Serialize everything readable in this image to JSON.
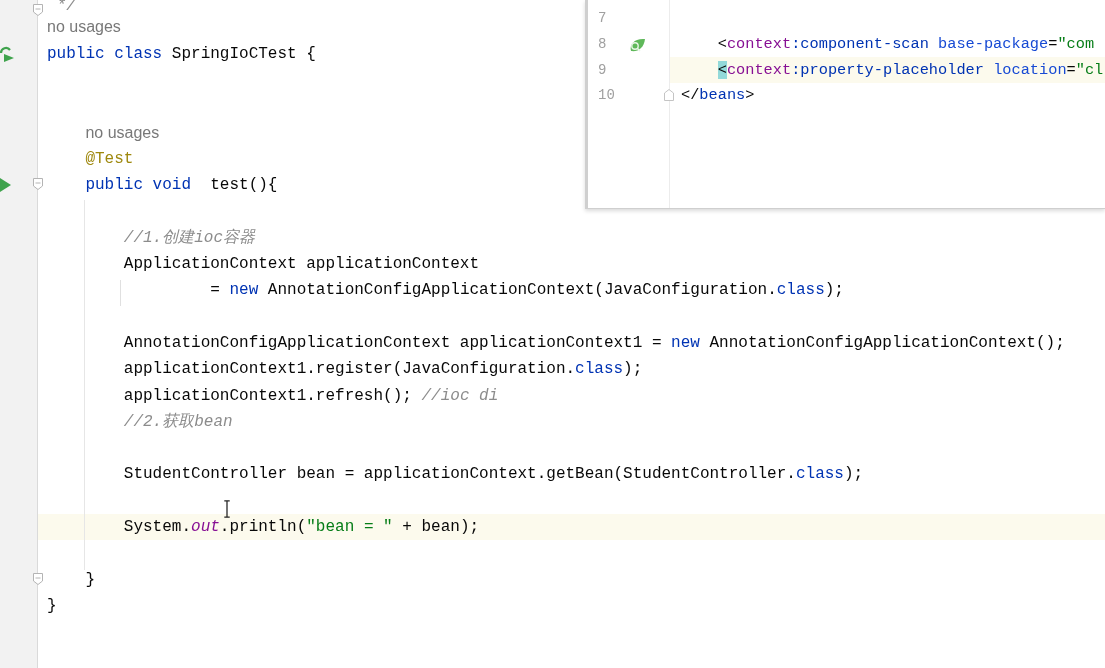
{
  "editor": {
    "lines": [
      {
        "kind": "code",
        "markers": [
          {
            "kind": "fold"
          }
        ],
        "tokens": [
          {
            "text": " */",
            "kind": "comment"
          }
        ]
      },
      {
        "kind": "hint",
        "text": "no usages"
      },
      {
        "kind": "code",
        "markers": [
          {
            "kind": "run-class"
          }
        ],
        "tokens": [
          {
            "text": "public class ",
            "kind": "keyword"
          },
          {
            "text": "SpringIoCTest {",
            "kind": "plain"
          }
        ]
      },
      {
        "kind": "blank"
      },
      {
        "kind": "blank"
      },
      {
        "kind": "hint",
        "text": "    no usages"
      },
      {
        "kind": "code",
        "tokens": [
          {
            "text": "    @Test",
            "kind": "annotation"
          }
        ]
      },
      {
        "kind": "code",
        "markers": [
          {
            "kind": "run"
          },
          {
            "kind": "fold"
          }
        ],
        "tokens": [
          {
            "text": "    public void ",
            "kind": "keyword"
          },
          {
            "text": " test(){",
            "kind": "plain"
          }
        ]
      },
      {
        "kind": "blank"
      },
      {
        "kind": "code",
        "tokens": [
          {
            "text": "        //1.创建ioc容器",
            "kind": "comment"
          }
        ]
      },
      {
        "kind": "code",
        "tokens": [
          {
            "text": "        ApplicationContext applicationContext",
            "kind": "plain"
          }
        ]
      },
      {
        "kind": "code",
        "tokens": [
          {
            "text": "                 = ",
            "kind": "plain"
          },
          {
            "text": "new ",
            "kind": "keyword"
          },
          {
            "text": "AnnotationConfigApplicationContext(JavaConfiguration.",
            "kind": "plain"
          },
          {
            "text": "class",
            "kind": "keyword"
          },
          {
            "text": ");",
            "kind": "plain"
          }
        ]
      },
      {
        "kind": "blank"
      },
      {
        "kind": "code",
        "tokens": [
          {
            "text": "        AnnotationConfigApplicationContext applicationContext1 = ",
            "kind": "plain"
          },
          {
            "text": "new ",
            "kind": "keyword"
          },
          {
            "text": "AnnotationConfigApplicationContext();",
            "kind": "plain"
          }
        ]
      },
      {
        "kind": "code",
        "tokens": [
          {
            "text": "        applicationContext1.register(JavaConfiguration.",
            "kind": "plain"
          },
          {
            "text": "class",
            "kind": "keyword"
          },
          {
            "text": ");",
            "kind": "plain"
          }
        ]
      },
      {
        "kind": "code",
        "tokens": [
          {
            "text": "        applicationContext1.refresh(); ",
            "kind": "plain"
          },
          {
            "text": "//ioc di",
            "kind": "comment"
          }
        ]
      },
      {
        "kind": "code",
        "tokens": [
          {
            "text": "        //2.获取bean",
            "kind": "comment"
          }
        ]
      },
      {
        "kind": "blank"
      },
      {
        "kind": "code",
        "tokens": [
          {
            "text": "        StudentController bean = applicationContext.getBean(StudentController.",
            "kind": "plain"
          },
          {
            "text": "class",
            "kind": "keyword"
          },
          {
            "text": ");",
            "kind": "plain"
          }
        ]
      },
      {
        "kind": "blank"
      },
      {
        "kind": "code",
        "current": true,
        "tokens": [
          {
            "text": "        System.",
            "kind": "plain"
          },
          {
            "text": "out",
            "kind": "static-field"
          },
          {
            "text": ".println(",
            "kind": "plain"
          },
          {
            "text": "\"bean = \"",
            "kind": "string"
          },
          {
            "text": " + bean);",
            "kind": "plain"
          }
        ]
      },
      {
        "kind": "blank"
      },
      {
        "kind": "code",
        "markers": [
          {
            "kind": "fold"
          }
        ],
        "tokens": [
          {
            "text": "    }",
            "kind": "plain"
          }
        ]
      },
      {
        "kind": "code",
        "tokens": [
          {
            "text": "}",
            "kind": "plain"
          }
        ]
      }
    ]
  },
  "popup": {
    "lines": [
      {
        "number": "7"
      },
      {
        "number": "8",
        "markers": [
          {
            "kind": "bean"
          }
        ],
        "tokens": [
          {
            "text": "    <",
            "kind": "plain"
          },
          {
            "text": "context",
            "kind": "xml-ns"
          },
          {
            "text": ":component-scan ",
            "kind": "xml-tag"
          },
          {
            "text": "base-package",
            "kind": "xml-attr"
          },
          {
            "text": "=",
            "kind": "plain"
          },
          {
            "text": "\"com",
            "kind": "xml-value"
          }
        ]
      },
      {
        "number": "9",
        "current": true,
        "tokens": [
          {
            "text": "    <",
            "kind": "matched-bracket"
          },
          {
            "text": "context",
            "kind": "xml-ns"
          },
          {
            "text": ":property-placeholder ",
            "kind": "xml-tag"
          },
          {
            "text": "location",
            "kind": "xml-attr"
          },
          {
            "text": "=",
            "kind": "plain"
          },
          {
            "text": "\"cl",
            "kind": "xml-value"
          }
        ]
      },
      {
        "number": "10",
        "markers": [
          {
            "kind": "fold"
          }
        ],
        "tokens": [
          {
            "text": "</",
            "kind": "plain"
          },
          {
            "text": "beans",
            "kind": "xml-tag"
          },
          {
            "text": ">",
            "kind": "plain"
          }
        ]
      }
    ]
  }
}
